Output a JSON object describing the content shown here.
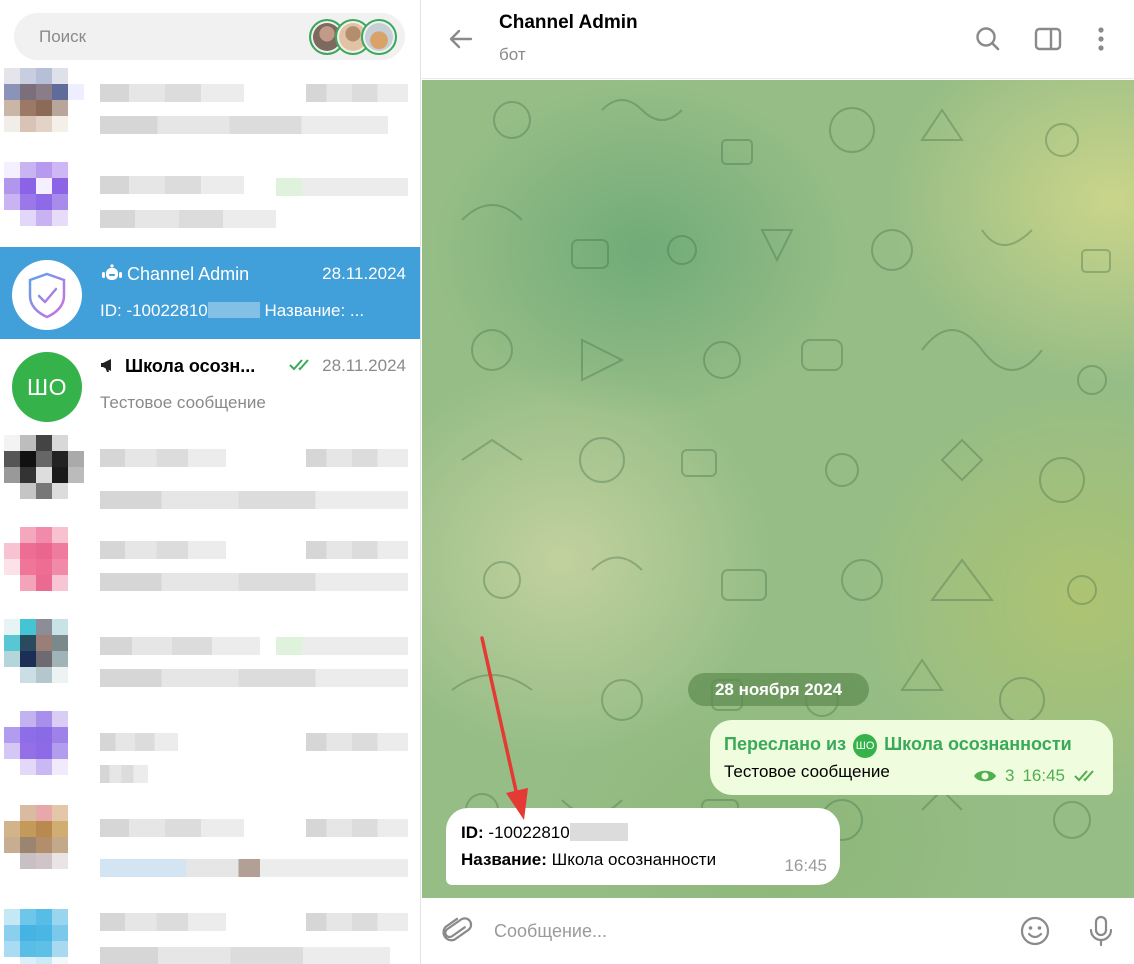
{
  "search": {
    "placeholder": "Поиск"
  },
  "sidebar": {
    "chats": [
      {
        "title": "Channel Admin",
        "date": "28.11.2024",
        "preview_id": "ID: -10022810",
        "preview_rest": "Название: ...",
        "icon": "bot-icon",
        "avatar_icon": "shield-check-icon",
        "active": true
      },
      {
        "title": "Школа осозн...",
        "date": "28.11.2024",
        "preview": "Тестовое сообщение",
        "icon": "megaphone-icon",
        "avatar_initials": "ШО",
        "read_status": "double-check-icon"
      }
    ]
  },
  "chat": {
    "title": "Channel Admin",
    "status": "бот",
    "header_icons": [
      "back-arrow-icon",
      "search-icon",
      "sidebar-toggle-icon",
      "more-vertical-icon"
    ],
    "date_separator": "28 ноября 2024",
    "messages": [
      {
        "direction": "out",
        "forwarded_prefix": "Переслано из",
        "forwarded_initials": "ШО",
        "forwarded_from": "Школа осознанности",
        "text": "Тестовое сообщение",
        "views": "3",
        "time": "16:45"
      },
      {
        "direction": "in",
        "id_label": "ID:",
        "id_value": "-10022810",
        "name_label": "Название:",
        "name_value": "Школа осознанности",
        "time": "16:45"
      }
    ]
  },
  "composer": {
    "placeholder": "Сообщение...",
    "icons": [
      "paperclip-icon",
      "emoji-icon",
      "microphone-icon"
    ]
  },
  "colors": {
    "active_row": "#419fd9",
    "accent_green": "#3aa95a",
    "annotation_arrow": "#e53935"
  }
}
